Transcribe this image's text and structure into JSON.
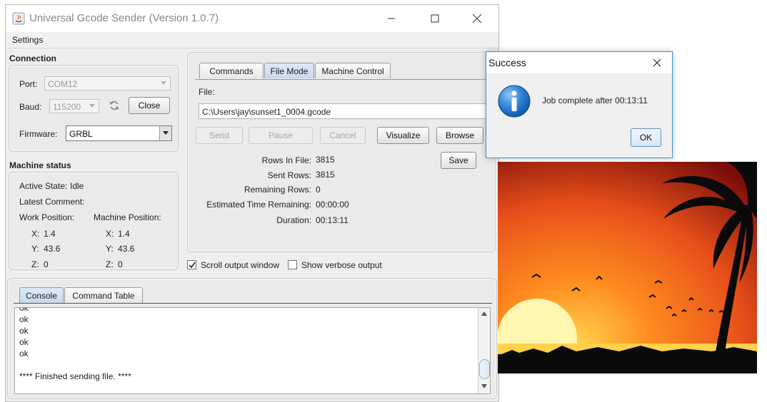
{
  "window": {
    "title": "Universal Gcode Sender (Version 1.0.7)",
    "menu": [
      "Settings"
    ]
  },
  "connection": {
    "title": "Connection",
    "port_label": "Port:",
    "port_value": "COM12",
    "baud_label": "Baud:",
    "baud_value": "115200",
    "close_label": "Close",
    "firmware_label": "Firmware:",
    "firmware_value": "GRBL"
  },
  "machine_status": {
    "title": "Machine status",
    "active_state_label": "Active State:",
    "active_state_value": "Idle",
    "latest_comment_label": "Latest Comment:",
    "work_position_label": "Work Position:",
    "machine_position_label": "Machine Position:",
    "work": {
      "x_label": "X:",
      "x": "1.4",
      "y_label": "Y:",
      "y": "43.6",
      "z_label": "Z:",
      "z": "0"
    },
    "machine": {
      "x_label": "X:",
      "x": "1.4",
      "y_label": "Y:",
      "y": "43.6",
      "z_label": "Z:",
      "z": "0"
    }
  },
  "tabs": {
    "commands": "Commands",
    "file_mode": "File Mode",
    "machine_control": "Machine Control",
    "selected": "File Mode"
  },
  "file_mode": {
    "file_label": "File:",
    "file_path": "C:\\Users\\jay\\sunset1_0004.gcode",
    "send": "Send",
    "pause": "Pause",
    "cancel": "Cancel",
    "visualize": "Visualize",
    "browse": "Browse",
    "save": "Save",
    "rows_in_file_label": "Rows In File:",
    "rows_in_file": "3815",
    "sent_rows_label": "Sent Rows:",
    "sent_rows": "3815",
    "remaining_rows_label": "Remaining Rows:",
    "remaining_rows": "0",
    "est_time_label": "Estimated Time Remaining:",
    "est_time": "00:00:00",
    "duration_label": "Duration:",
    "duration": "00:13:11"
  },
  "options": {
    "scroll_output": "Scroll output window",
    "scroll_output_checked": true,
    "verbose_output": "Show verbose output",
    "verbose_output_checked": false
  },
  "console": {
    "tab_console": "Console",
    "tab_command_table": "Command Table",
    "lines": [
      "ok",
      "ok",
      "ok",
      "ok",
      "",
      "**** Finished sending file. ****"
    ]
  },
  "dialog": {
    "title": "Success",
    "message": "Job complete after 00:13:11",
    "ok": "OK",
    "icon": "info-icon"
  },
  "colors": {
    "tab_selected": "#c8d8ea",
    "dialog_border": "#3a8fd6",
    "info_icon": "#1a6fc4",
    "sunset_sky": "#e8501a",
    "sun": "#fff6b0"
  }
}
